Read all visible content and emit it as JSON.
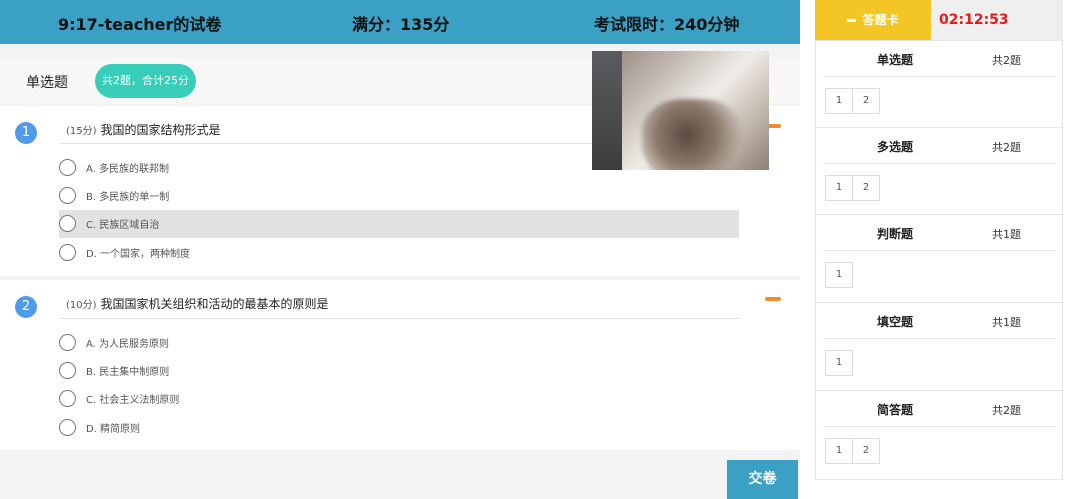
{
  "header": {
    "title": "9:17-teacher的试卷",
    "total_score": "满分：135分",
    "time_limit": "考试限时：240分钟"
  },
  "section": {
    "name": "单选题",
    "badge": "共2题，合计25分"
  },
  "questions": [
    {
      "number": "1",
      "points": "(15分)",
      "text": "我国的国家结构形式是",
      "options": [
        "A. 多民族的联邦制",
        "B. 多民族的单一制",
        "C. 民族区域自治",
        "D. 一个国家，两种制度"
      ],
      "selected_index": 2
    },
    {
      "number": "2",
      "points": "(10分)",
      "text": "我国国家机关组织和活动的最基本的原则是",
      "options": [
        "A. 为人民服务原则",
        "B. 民主集中制原则",
        "C. 社会主义法制原则",
        "D. 精简原则"
      ],
      "selected_index": null
    }
  ],
  "submit_label": "交卷",
  "answer_card": {
    "tab_label": "答题卡",
    "timer": "02:12:53",
    "categories": [
      {
        "name": "单选题",
        "count": "共2题",
        "items": [
          "1",
          "2"
        ]
      },
      {
        "name": "多选题",
        "count": "共2题",
        "items": [
          "1",
          "2"
        ]
      },
      {
        "name": "判断题",
        "count": "共1题",
        "items": [
          "1"
        ]
      },
      {
        "name": "填空题",
        "count": "共1题",
        "items": [
          "1"
        ]
      },
      {
        "name": "简答题",
        "count": "共2题",
        "items": [
          "1",
          "2"
        ]
      }
    ]
  },
  "colors": {
    "header_bg": "#3aa0c4",
    "badge_bg": "#38cdb8",
    "answer_card_tab": "#f3c625",
    "timer_text": "#e01c1c",
    "question_number": "#4f9be8",
    "mark_orange": "#f08c2e"
  }
}
